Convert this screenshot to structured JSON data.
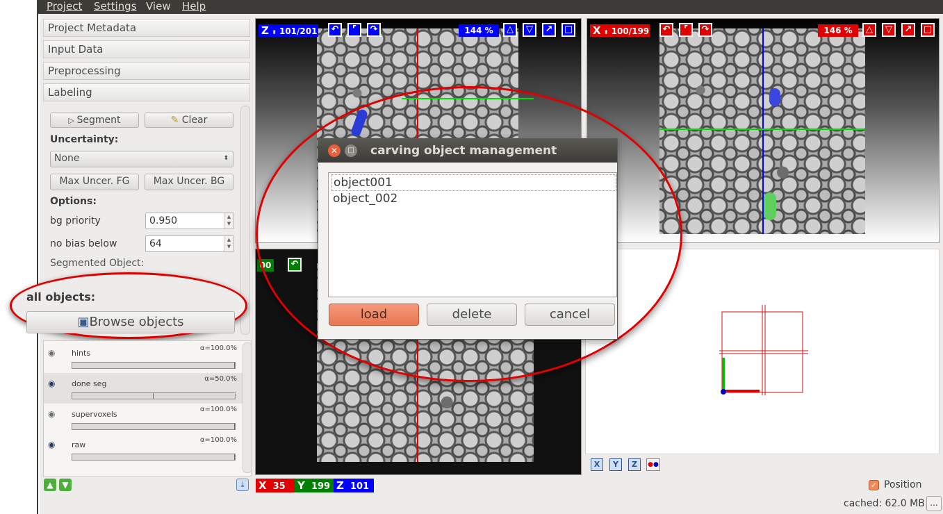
{
  "menubar": {
    "items": [
      "Project",
      "Settings",
      "View",
      "Help"
    ]
  },
  "applets": {
    "sections": [
      "Project Metadata",
      "Input Data",
      "Preprocessing",
      "Labeling"
    ]
  },
  "labeling": {
    "segment_label": "Segment",
    "clear_label": "Clear",
    "uncertainty_label": "Uncertainty:",
    "uncertainty_value": "None",
    "max_uncer_fg_label": "Max Uncer. FG",
    "max_uncer_bg_label": "Max Uncer. BG",
    "options_label": "Options:",
    "bg_priority_label": "bg priority",
    "bg_priority_value": "0.950",
    "no_bias_label": "no bias below",
    "no_bias_value": "64",
    "segmented_object_label": "Segmented Object:",
    "all_objects_label": "all objects:",
    "browse_objects_label": "Browse objects"
  },
  "layers": [
    {
      "name": "hints",
      "alpha": "α=100.0%",
      "opacity": 1.0
    },
    {
      "name": "done seg",
      "alpha": "α=50.0%",
      "opacity": 0.5
    },
    {
      "name": "supervoxels",
      "alpha": "α=100.0%",
      "opacity": 1.0
    },
    {
      "name": "raw",
      "alpha": "α=100.0%",
      "opacity": 1.0
    }
  ],
  "views": {
    "z": {
      "axis": "Z",
      "slice": "101/201",
      "zoom": "144 %",
      "color": "#0000ff"
    },
    "x": {
      "axis": "X",
      "slice": "100/199",
      "zoom": "146 %",
      "color": "#e00000"
    },
    "y": {
      "label": "00"
    }
  },
  "view3d": {
    "buttons": [
      "X",
      "Y",
      "Z"
    ]
  },
  "position": {
    "x_label": "X",
    "x_value": "35",
    "y_label": "Y",
    "y_value": "199",
    "z_label": "Z",
    "z_value": "101",
    "show_label": "Position",
    "show_checked": true
  },
  "status": {
    "cached": "cached: 62.0 MB",
    "more_label": "..."
  },
  "dialog": {
    "title": "carving object management",
    "objects": [
      "object001",
      "object_002"
    ],
    "load_label": "load",
    "delete_label": "delete",
    "cancel_label": "cancel"
  },
  "colors": {
    "accent_red": "#e00000",
    "blue": "#0000ff",
    "green": "#008000",
    "load_button": "#e87652"
  }
}
